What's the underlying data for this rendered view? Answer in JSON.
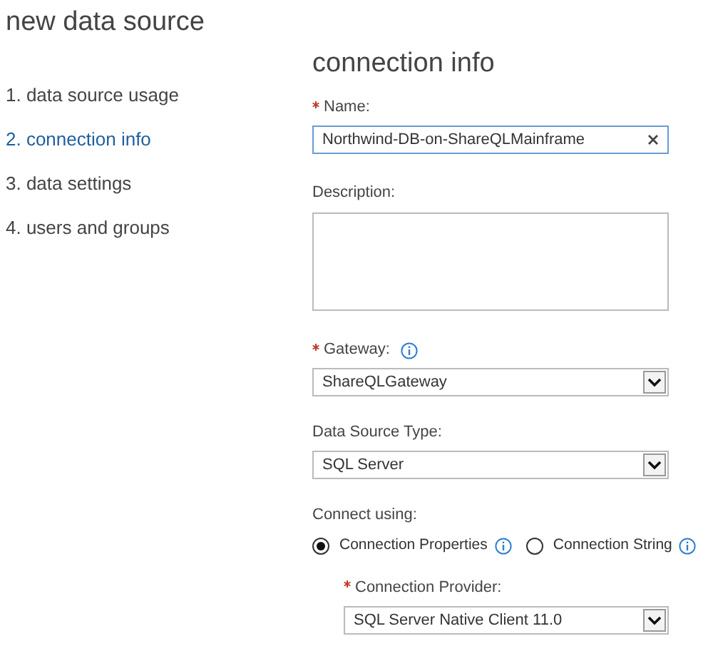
{
  "title": "new data source",
  "steps": [
    {
      "label": "1. data source usage",
      "selected": false
    },
    {
      "label": "2. connection info",
      "selected": true
    },
    {
      "label": "3. data settings",
      "selected": false
    },
    {
      "label": "4. users and groups",
      "selected": false
    }
  ],
  "section_title": "connection info",
  "fields": [
    {
      "kind": "text",
      "label": "Name:",
      "required": true,
      "info": false,
      "value": "Northwind-DB-on-ShareQLMainframe",
      "focused": true
    },
    {
      "kind": "textarea",
      "label": "Description:",
      "required": false,
      "info": false
    },
    {
      "kind": "select",
      "label": "Gateway:",
      "required": true,
      "info": true,
      "value": "ShareQLGateway",
      "indented": false
    },
    {
      "kind": "select",
      "label": "Data Source Type:",
      "required": false,
      "info": false,
      "value": "SQL Server",
      "indented": false
    },
    {
      "kind": "radio",
      "label": "Connect using:",
      "required": false,
      "info": false,
      "options": [
        {
          "label": "Connection Properties",
          "selected": true,
          "info": true
        },
        {
          "label": "Connection String",
          "selected": false,
          "info": true
        }
      ]
    },
    {
      "kind": "select",
      "label": "Connection Provider:",
      "required": true,
      "info": false,
      "value": "SQL Server Native Client 11.0",
      "indented": true
    }
  ]
}
